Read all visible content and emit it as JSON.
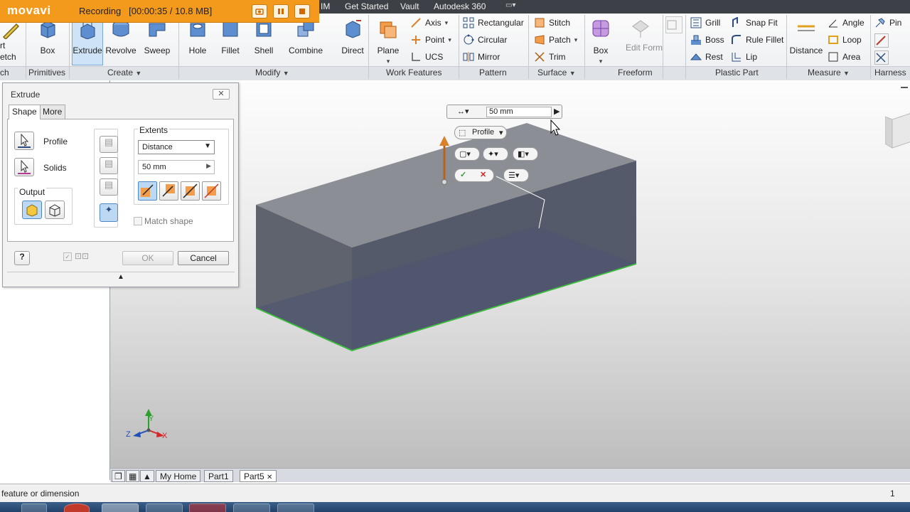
{
  "recorder": {
    "logo": "movavi",
    "status": "Recording",
    "time_size": "[00:00:35 / 10.8 MB]"
  },
  "menubar": {
    "items": [
      "IM",
      "Get Started",
      "Vault",
      "Autodesk 360"
    ]
  },
  "ribbon": {
    "sketch": {
      "start_label": "rt",
      "sketch_label": "etch",
      "panel": "ch"
    },
    "primitives": {
      "box": "Box",
      "panel": "Primitives"
    },
    "create": {
      "extrude": "Extrude",
      "revolve": "Revolve",
      "sweep": "Sweep",
      "panel": "Create"
    },
    "modify": {
      "hole": "Hole",
      "fillet": "Fillet",
      "shell": "Shell",
      "combine": "Combine",
      "direct": "Direct",
      "panel": "Modify"
    },
    "work_features": {
      "plane": "Plane",
      "axis": "Axis",
      "point": "Point",
      "ucs": "UCS",
      "panel": "Work Features"
    },
    "pattern": {
      "rectangular": "Rectangular",
      "circular": "Circular",
      "mirror": "Mirror",
      "panel": "Pattern"
    },
    "surface": {
      "stitch": "Stitch",
      "patch": "Patch",
      "trim": "Trim",
      "panel": "Surface"
    },
    "freeform": {
      "box": "Box",
      "edit_form": "Edit Form",
      "panel": "Freeform"
    },
    "plastic_part": {
      "grill": "Grill",
      "boss": "Boss",
      "rest": "Rest",
      "snap_fit": "Snap Fit",
      "rule_fillet": "Rule Fillet",
      "lip": "Lip",
      "panel": "Plastic Part"
    },
    "measure": {
      "distance": "Distance",
      "angle": "Angle",
      "loop": "Loop",
      "area": "Area",
      "panel": "Measure"
    },
    "harness": {
      "pin": "Pin",
      "panel": "Harness"
    }
  },
  "dialog": {
    "title": "Extrude",
    "tabs": [
      "Shape",
      "More"
    ],
    "profile_label": "Profile",
    "solids_label": "Solids",
    "output_label": "Output",
    "extents_label": "Extents",
    "extents_value": "Distance",
    "distance_value": "50 mm",
    "match_shape": "Match shape",
    "ok": "OK",
    "cancel": "Cancel"
  },
  "canvas": {
    "distance_input": "50 mm",
    "profile_button": "Profile",
    "axis_labels": {
      "x": "X",
      "y": "Y",
      "z": "Z"
    }
  },
  "doctabs": [
    "My Home",
    "Part1",
    "Part5"
  ],
  "status": {
    "prompt": "feature or dimension",
    "count": "1"
  },
  "colors": {
    "recorder": "#f39a1d",
    "selected_edge": "#3dbd3d",
    "solid_top": "#8c8e95",
    "solid_side": "#4c5365"
  }
}
